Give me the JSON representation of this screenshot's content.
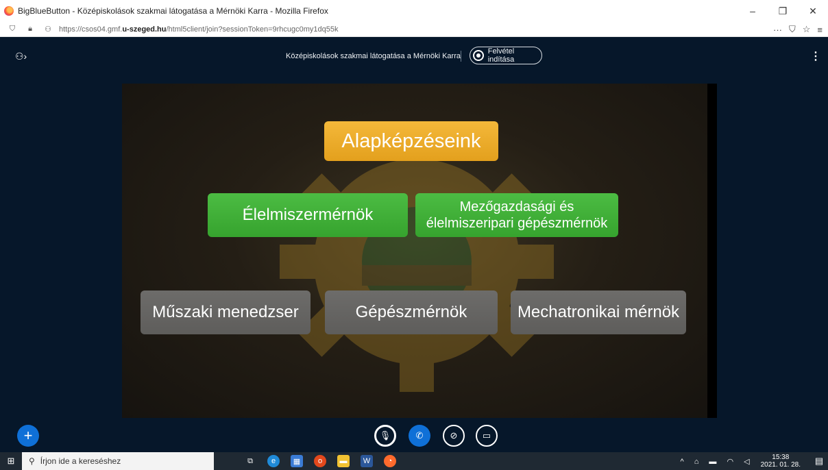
{
  "browser": {
    "window_title": "BigBlueButton - Középiskolások szakmai látogatása a Mérnöki Karra - Mozilla Firefox",
    "url_prefix": "https://csos04.gmf.",
    "url_domain": "u-szeged.hu",
    "url_suffix": "/html5client/join?sessionToken=9rhcugc0my1dq55k",
    "controls": {
      "minimize": "–",
      "restore": "❐",
      "close": "✕"
    },
    "toolbar_icons": [
      "shield-icon",
      "lock-icon",
      "permissions-icon",
      "more-icon",
      "pocket-icon",
      "bookmark-star-icon",
      "menu-icon"
    ]
  },
  "app": {
    "meeting_title": "Középiskolások szakmai látogatása a Mérnöki Karra",
    "record_label": "Felvétel indítása",
    "kebab_label": "⋮"
  },
  "slide": {
    "title": "Alapképzéseink",
    "programs_green": [
      "Élelmiszermérnök",
      "Mezőgazdasági és\nélelmiszeripari gépészmérnök"
    ],
    "programs_gray": [
      "Műszaki menedzser",
      "Gépészmérnök",
      "Mechatronikai mérnök"
    ],
    "colors": {
      "orange": "#e8a624",
      "green": "#3fae37",
      "gray": "#646361",
      "app_bg": "#06172a",
      "primary": "#0f70d7"
    }
  },
  "controls": {
    "actions_label": "+",
    "icons": [
      "muted-mic-icon",
      "phone-icon",
      "camera-off-icon",
      "screen-share-off-icon"
    ]
  },
  "taskbar": {
    "search_placeholder": "Írjon ide a kereséshez",
    "time": "15:38",
    "date": "2021. 01. 28."
  }
}
